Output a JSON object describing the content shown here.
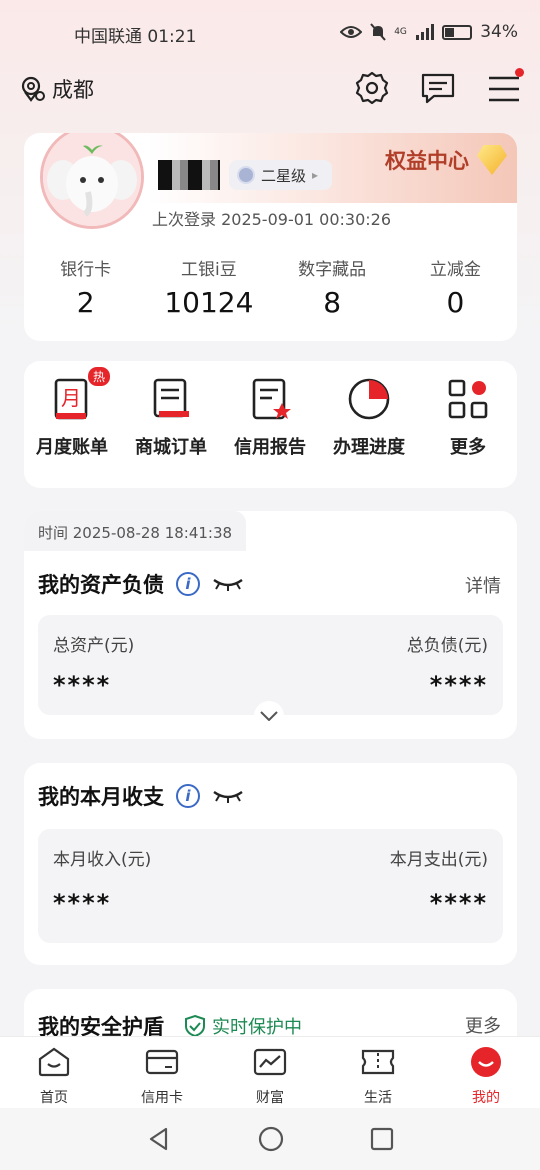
{
  "status_bar": {
    "carrier_time": "中国联通 01:21",
    "network": "4G",
    "battery": "34%"
  },
  "header": {
    "location": "成都"
  },
  "profile": {
    "star_level": "二星级",
    "rights_center": "权益中心",
    "last_login": "上次登录 2025-09-01 00:30:26",
    "stats": [
      {
        "label": "银行卡",
        "value": "2"
      },
      {
        "label": "工银i豆",
        "value": "10124"
      },
      {
        "label": "数字藏品",
        "value": "8"
      },
      {
        "label": "立减金",
        "value": "0"
      }
    ]
  },
  "shortcuts": {
    "hot_badge": "热",
    "items": [
      {
        "label": "月度账单",
        "icon": "monthly-bill-icon"
      },
      {
        "label": "商城订单",
        "icon": "mall-order-icon"
      },
      {
        "label": "信用报告",
        "icon": "credit-report-icon"
      },
      {
        "label": "办理进度",
        "icon": "progress-icon"
      },
      {
        "label": "更多",
        "icon": "more-grid-icon"
      }
    ],
    "month_glyph": "月"
  },
  "assets": {
    "time": "时间 2025-08-28 18:41:38",
    "title": "我的资产负债",
    "detail": "详情",
    "total_assets_label": "总资产(元)",
    "total_assets_value": "****",
    "total_debt_label": "总负债(元)",
    "total_debt_value": "****"
  },
  "income": {
    "title": "我的本月收支",
    "income_label": "本月收入(元)",
    "income_value": "****",
    "expense_label": "本月支出(元)",
    "expense_value": "****"
  },
  "security": {
    "title": "我的安全护盾",
    "status": "实时保护中",
    "more": "更多"
  },
  "tabbar": {
    "items": [
      {
        "label": "首页"
      },
      {
        "label": "信用卡"
      },
      {
        "label": "财富"
      },
      {
        "label": "生活"
      },
      {
        "label": "我的"
      }
    ],
    "active_index": 4
  },
  "colors": {
    "accent": "#e5252a",
    "info": "#3a6ac5",
    "protect": "#1c8a52",
    "rights": "#b13e28"
  }
}
